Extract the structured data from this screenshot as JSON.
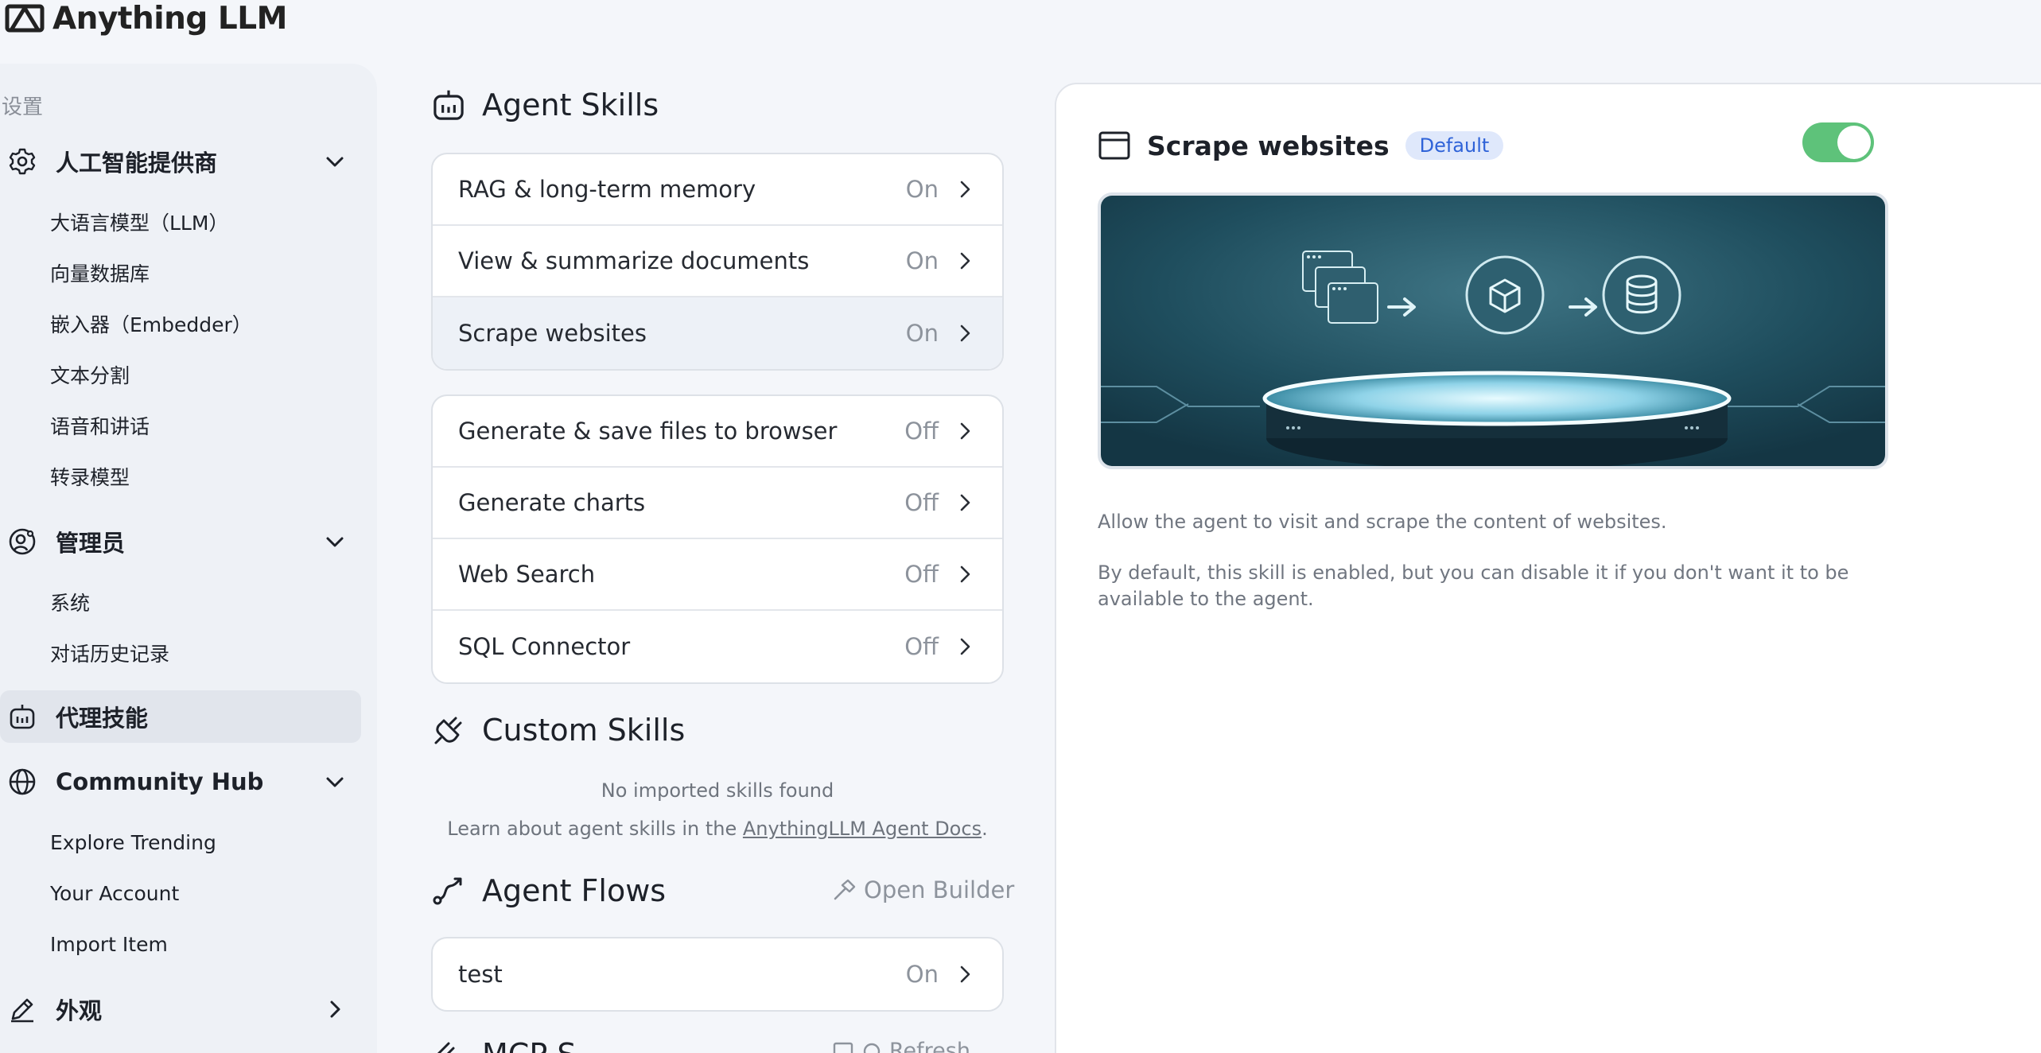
{
  "brand": {
    "name": "Anything LLM"
  },
  "sidebar": {
    "settings_label": "设置",
    "ai_providers": {
      "label": "人工智能提供商",
      "items": [
        "大语言模型（LLM）",
        "向量数据库",
        "嵌入器（Embedder）",
        "文本分割",
        "语音和讲话",
        "转录模型"
      ]
    },
    "admin": {
      "label": "管理员",
      "items": [
        "系统",
        "对话历史记录"
      ]
    },
    "agent_skills": {
      "label": "代理技能"
    },
    "community_hub": {
      "label": "Community Hub",
      "items": [
        "Explore Trending",
        "Your Account",
        "Import Item"
      ]
    },
    "appearance": {
      "label": "外观"
    }
  },
  "agent_skills": {
    "title": "Agent Skills",
    "default_skills": [
      {
        "name": "RAG & long-term memory",
        "state": "On"
      },
      {
        "name": "View & summarize documents",
        "state": "On"
      },
      {
        "name": "Scrape websites",
        "state": "On"
      }
    ],
    "configurable_skills": [
      {
        "name": "Generate & save files to browser",
        "state": "Off"
      },
      {
        "name": "Generate charts",
        "state": "Off"
      },
      {
        "name": "Web Search",
        "state": "Off"
      },
      {
        "name": "SQL Connector",
        "state": "Off"
      }
    ]
  },
  "custom_skills": {
    "title": "Custom Skills",
    "empty_text": "No imported skills found",
    "learn_prefix": "Learn about agent skills in the ",
    "learn_link": "AnythingLLM Agent Docs",
    "learn_suffix": "."
  },
  "agent_flows": {
    "title": "Agent Flows",
    "open_builder": "Open Builder",
    "flows": [
      {
        "name": "test",
        "state": "On"
      }
    ]
  },
  "mcp": {
    "title": "MCP S",
    "action": "Refresh"
  },
  "detail": {
    "title": "Scrape websites",
    "badge": "Default",
    "enabled": true,
    "description_1": "Allow the agent to visit and scrape the content of websites.",
    "description_2": "By default, this skill is enabled, but you can disable it if you don't want it to be available to the agent."
  },
  "colors": {
    "toggle_on": "#5ec27a",
    "badge_bg": "#dfe8fb",
    "badge_text": "#2f63d8",
    "hero_bg": "#1e4a5a"
  }
}
